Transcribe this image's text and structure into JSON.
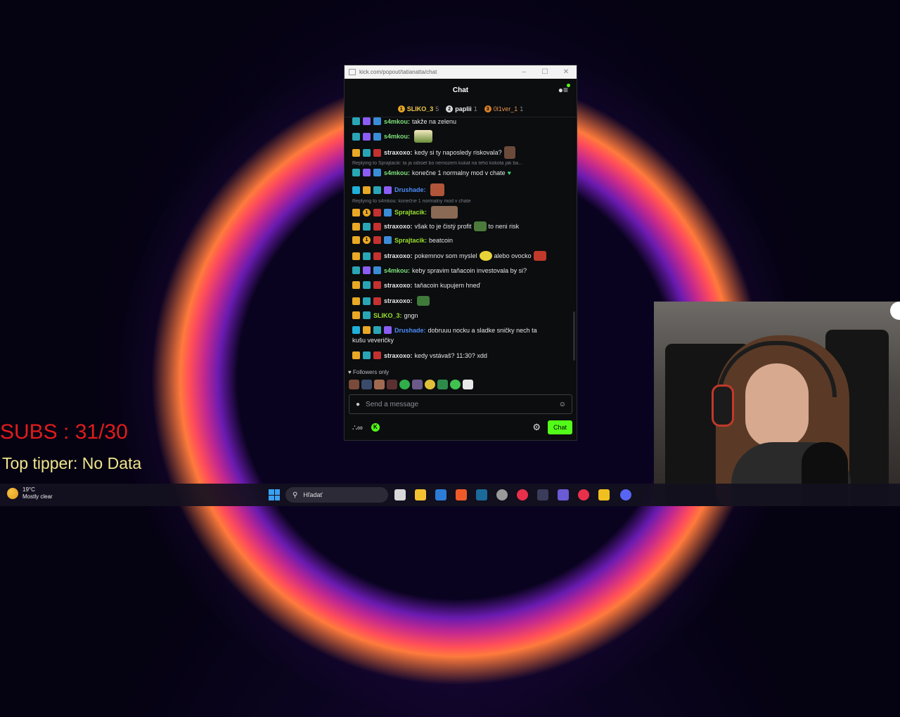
{
  "overlay": {
    "subs": "SUBS : 31/30",
    "top_tipper": "Top tipper: No Data"
  },
  "window": {
    "url": "kick.com/popout/tatianatta/chat",
    "title": "Chat",
    "controls": [
      "–",
      "☐",
      "✕"
    ]
  },
  "leaderboard": [
    {
      "rank": "1",
      "name": "SLIKO_3",
      "count": "5",
      "color": "#f2c94c"
    },
    {
      "rank": "2",
      "name": "paplii",
      "count": "1",
      "color": "#e6e6e6"
    },
    {
      "rank": "3",
      "name": "0l1ver_1",
      "count": "1",
      "color": "#e9924a"
    }
  ],
  "messages": [
    {
      "user": "s4mkou:",
      "text": "takže na zelenu",
      "color": "#7ee07a"
    },
    {
      "user": "s4mkou:",
      "text": "",
      "color": "#7ee07a"
    },
    {
      "user": "straxoxo:",
      "text": "kedy si ty naposledy riskovala?",
      "color": "#e6e6e6"
    },
    {
      "reply": "Replying to Sprajtacik: ta ja odisiel bo nemozem kukat na teho kokota jak ba..."
    },
    {
      "user": "s4mkou:",
      "text": "konečne 1 normalny mod v chate",
      "color": "#7ee07a"
    },
    {
      "user": "Drushade:",
      "text": "",
      "color": "#4f8cf7"
    },
    {
      "reply": "Replying to s4mkou: konečne 1 normalny mod v chate"
    },
    {
      "user": "Sprajtacik:",
      "text": "",
      "color": "#9be32f"
    },
    {
      "user": "straxoxo:",
      "text": "však to je čistý profit",
      "text2": "to neni risk",
      "color": "#e6e6e6"
    },
    {
      "user": "Sprajtacik:",
      "text": "beatcoin",
      "color": "#9be32f"
    },
    {
      "user": "straxoxo:",
      "text": "pokemnov som myslel",
      "text2": "alebo ovocko",
      "color": "#e6e6e6"
    },
    {
      "user": "s4mkou:",
      "text": "keby spravim taňacoin investovala by si?",
      "color": "#7ee07a"
    },
    {
      "user": "straxoxo:",
      "text": "taňacoin kupujem hneď",
      "color": "#e6e6e6"
    },
    {
      "user": "straxoxo:",
      "text": "",
      "color": "#e6e6e6"
    },
    {
      "user": "SLIKO_3:",
      "text": "gngn",
      "color": "#9be32f"
    },
    {
      "user": "Drushade:",
      "text": "dobruuu nocku a sladke sničky nech ta",
      "text2": "kušu veveričky",
      "color": "#4f8cf7"
    },
    {
      "user": "straxoxo:",
      "text": "kedy vstávaš? 11:30? xdd",
      "color": "#e6e6e6"
    }
  ],
  "followers_only": "Followers only",
  "input": {
    "placeholder": "Send a message"
  },
  "footer": {
    "chat_button": "Chat"
  },
  "taskbar": {
    "temp": "19°C",
    "weather": "Mostly clear",
    "search": "Hľadať"
  },
  "colors": {
    "kick_green": "#53fc18",
    "sub_red": "#e21b1b"
  }
}
